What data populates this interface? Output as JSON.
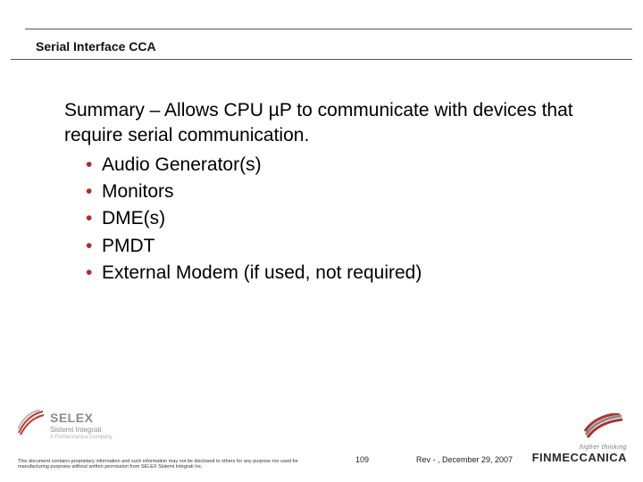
{
  "header": {
    "title": "Serial Interface CCA"
  },
  "body": {
    "summary": "Summary – Allows CPU µP to communicate with devices that require serial communication.",
    "bullets": [
      "Audio Generator(s)",
      "Monitors",
      "DME(s)",
      "PMDT",
      "External Modem (if used, not required)"
    ]
  },
  "footer": {
    "disclaimer": "This document contains proprietary information and such information may not be disclosed to others for any purpose nor used for manufacturing purposes without written permission from SELEX Sistemi Integrati Inc.",
    "page_number": "109",
    "rev": "Rev - , December 29, 2007",
    "logo_left": {
      "brand": "SELEX",
      "sub": "Sistemi Integrati",
      "sub2": "A Finmeccanica Company"
    },
    "logo_right": {
      "tagline": "higher thinking",
      "name": "FINMECCANICA"
    }
  }
}
